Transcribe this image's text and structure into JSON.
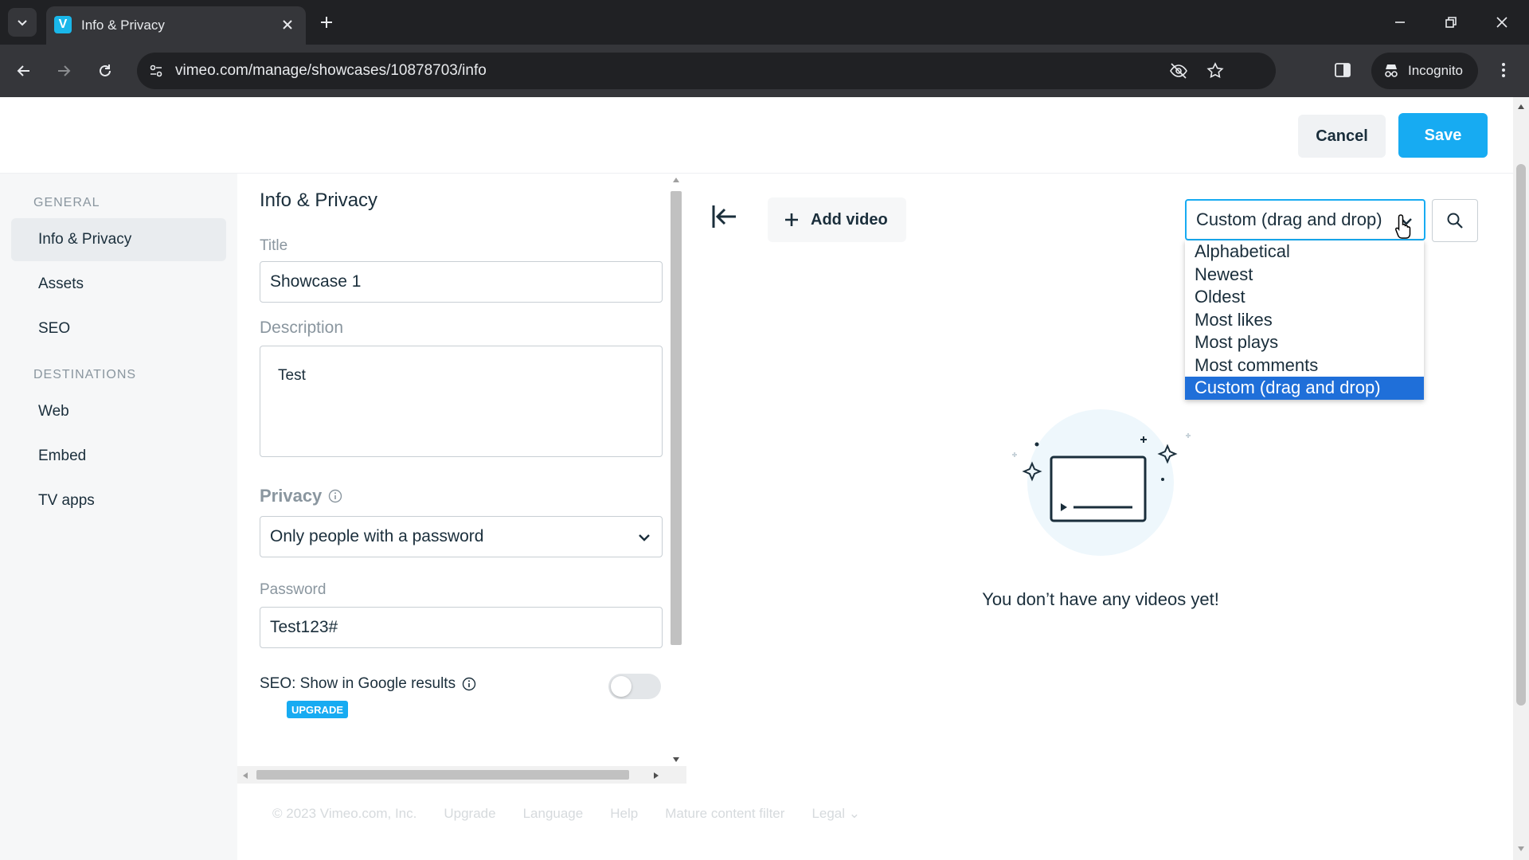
{
  "browser": {
    "tab_title": "Info & Privacy",
    "favicon_letter": "V",
    "url": "vimeo.com/manage/showcases/10878703/info",
    "incognito_label": "Incognito"
  },
  "header": {
    "cancel_label": "Cancel",
    "save_label": "Save"
  },
  "sidebar": {
    "general_header": "GENERAL",
    "general_items": [
      "Info & Privacy",
      "Assets",
      "SEO"
    ],
    "destinations_header": "DESTINATIONS",
    "destination_items": [
      "Web",
      "Embed",
      "TV apps"
    ],
    "active_item": "Info & Privacy"
  },
  "form": {
    "heading": "Info & Privacy",
    "title_label": "Title",
    "title_value": "Showcase 1",
    "description_label": "Description",
    "description_value": "Test",
    "privacy_label": "Privacy",
    "privacy_value": "Only people with a password",
    "password_label": "Password",
    "password_value": "Test123#",
    "seo_label": "SEO: Show in Google results",
    "upgrade_badge": "UPGRADE",
    "seo_enabled": false
  },
  "content": {
    "add_video_label": "Add video",
    "sort_value": "Custom (drag and drop)",
    "sort_options": [
      "Alphabetical",
      "Newest",
      "Oldest",
      "Most likes",
      "Most plays",
      "Most comments",
      "Custom (drag and drop)"
    ],
    "empty_message": "You don’t have any videos yet!"
  },
  "footer": {
    "copyright": "© 2023 Vimeo.com, Inc.",
    "upgrade": "Upgrade",
    "language": "Language",
    "help": "Help",
    "mature": "Mature content filter",
    "legal": "Legal ⌄"
  },
  "colors": {
    "accent": "#17abf2",
    "selected_option": "#1f6fd9"
  }
}
